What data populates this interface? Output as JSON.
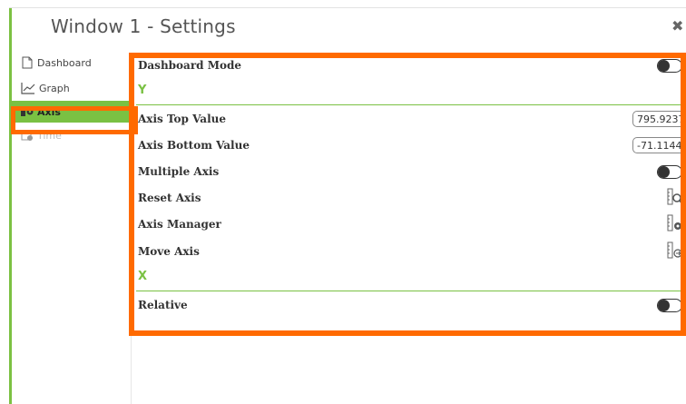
{
  "window": {
    "title": "Window 1 - Settings",
    "close_glyph": "✖"
  },
  "sidebar": {
    "items": [
      {
        "label": "Dashboard",
        "icon": "document-icon"
      },
      {
        "label": "Graph",
        "icon": "line-chart-icon"
      },
      {
        "label": "Axis",
        "icon": "axis-gear-icon",
        "active": true
      },
      {
        "label": "Time",
        "icon": "calendar-icon"
      }
    ]
  },
  "settings": {
    "dashboard_mode_label": "Dashboard Mode",
    "section_y": "Y",
    "axis_top_label": "Axis Top Value",
    "axis_top_value": "795.9237",
    "axis_bottom_label": "Axis Bottom Value",
    "axis_bottom_value": "-71.1144",
    "multiple_axis_label": "Multiple Axis",
    "reset_axis_label": "Reset Axis",
    "axis_manager_label": "Axis Manager",
    "move_axis_label": "Move Axis",
    "section_x": "X",
    "relative_label": "Relative"
  },
  "colors": {
    "accent": "#7ac143",
    "highlight": "#ff6a00"
  }
}
